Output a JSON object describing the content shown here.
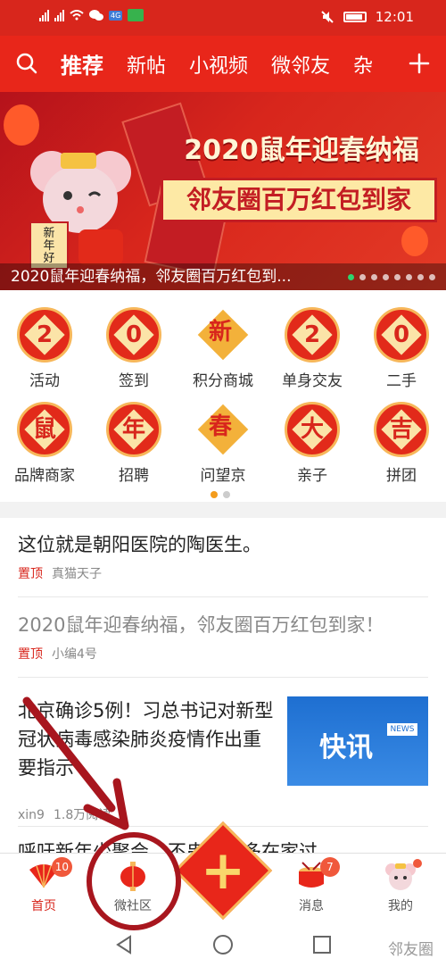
{
  "status_bar": {
    "time": "12:01",
    "chip_label": "4G"
  },
  "top_nav": {
    "tabs": [
      "推荐",
      "新帖",
      "小视频",
      "微邻友",
      "杂"
    ]
  },
  "banner": {
    "title_line1": "2020鼠年迎春纳福",
    "title_line2": "邻友圈百万红包到家",
    "scroll_text": "新年好",
    "caption": "2020鼠年迎春纳福，邻友圈百万红包到...",
    "page_dots": 8,
    "active_dot": 0
  },
  "grid": {
    "items": [
      {
        "glyph": "2",
        "label": "活动"
      },
      {
        "glyph": "0",
        "label": "签到"
      },
      {
        "glyph": "新",
        "label": "积分商城",
        "style": "fu"
      },
      {
        "glyph": "2",
        "label": "单身交友"
      },
      {
        "glyph": "0",
        "label": "二手"
      },
      {
        "glyph": "鼠",
        "label": "品牌商家"
      },
      {
        "glyph": "年",
        "label": "招聘"
      },
      {
        "glyph": "春",
        "label": "问望京",
        "style": "fu"
      },
      {
        "glyph": "大",
        "label": "亲子"
      },
      {
        "glyph": "吉",
        "label": "拼团"
      }
    ],
    "page_count": 2,
    "active_page": 0
  },
  "feed": {
    "posts": [
      {
        "title": "这位就是朝阳医院的陶医生。",
        "tag": "置顶",
        "author": "真猫天子"
      },
      {
        "title": "2020鼠年迎春纳福，邻友圈百万红包到家！",
        "tag": "置顶",
        "author": "小编4号"
      },
      {
        "title": "北京确诊5例！习总书记对新型冠状病毒感染肺炎疫情作出重要指示",
        "author": "xin9",
        "stats": "1.8万阅读",
        "thumb_text": "快讯",
        "thumb_badge": "NEWS"
      }
    ],
    "partial_title": "呼吁新年少聚会，不串门，多在家过…  …"
  },
  "tab_bar": {
    "items": [
      {
        "label": "首页",
        "badge": "10"
      },
      {
        "label": "微社区"
      },
      {
        "label": "消息",
        "badge": "7"
      },
      {
        "label": "我的"
      }
    ]
  },
  "watermark": "邻友圈",
  "colors": {
    "brand_red": "#e8261a",
    "annotation": "#a8161e",
    "gold": "#f7b75a"
  }
}
